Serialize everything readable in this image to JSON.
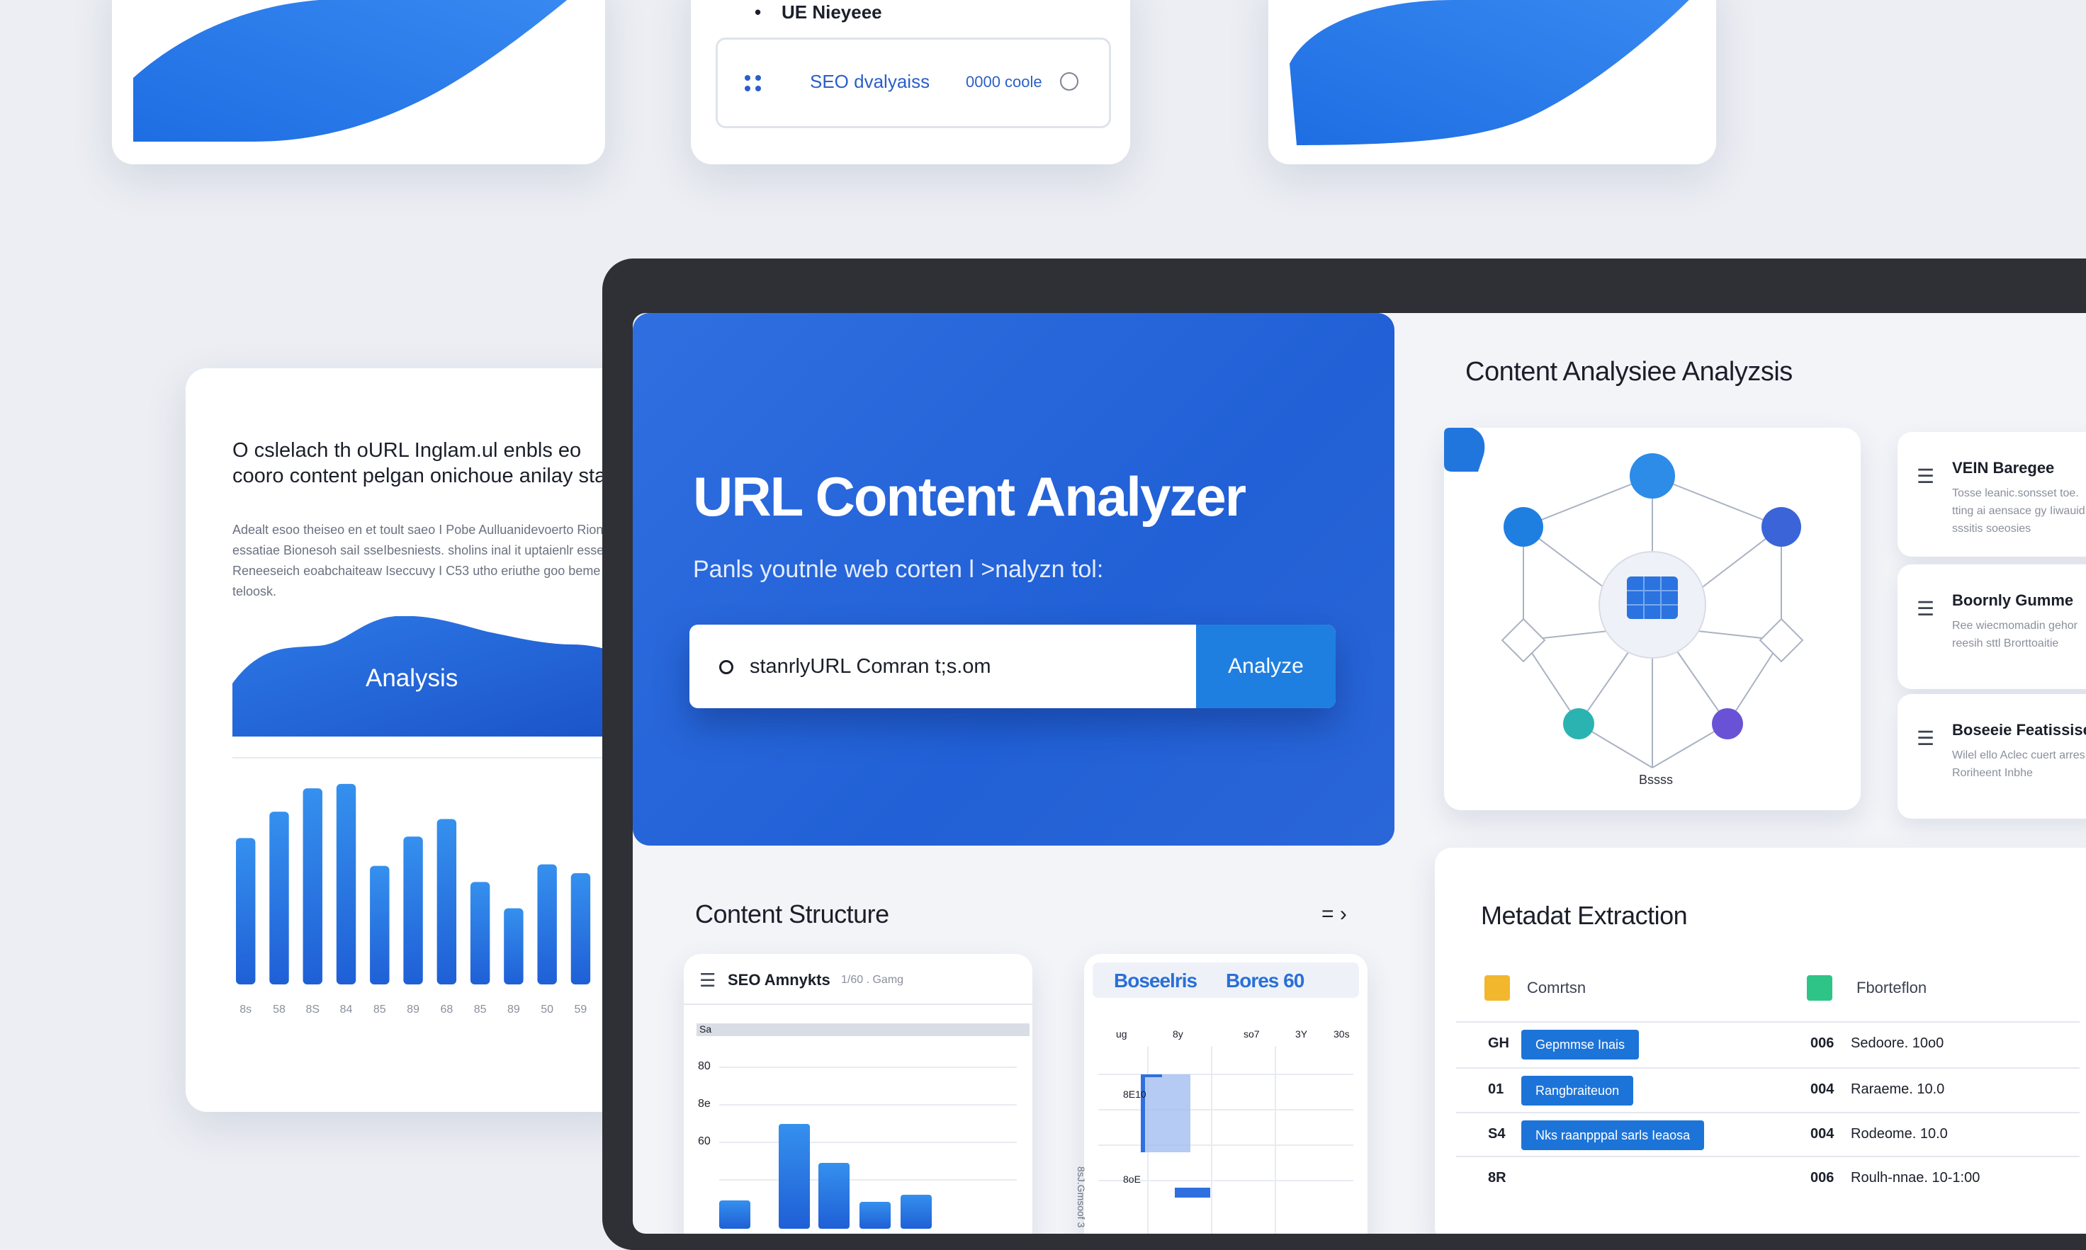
{
  "top_cards": {
    "middle": {
      "bullet_text": "UE Nieyeee",
      "seo_label": "SEO dvalyaiss",
      "value_label": "0000 coole"
    }
  },
  "left_card": {
    "title": "O cslelach th oURL Inglam.ul enbls eo cooro content pelgan onichoue anilay stact.",
    "body": "Adealt esoo theiseo en et toult saeo I Pobe Aulluanidevoerto Rionetur essatiae Bionesoh saiI sseIbesniests. sholins inal it uptaienlr essesh n Reneeseich eoabchaiteaw Iseccuvy I C53 utho eriuthe goo beme teloosk.",
    "wave_label": "Analysis"
  },
  "chart_data": {
    "type": "bar",
    "categories": [
      "8s",
      "58",
      "8S",
      "84",
      "85",
      "89",
      "68",
      "85",
      "89",
      "50",
      "59"
    ],
    "values": [
      100,
      118,
      134,
      137,
      81,
      101,
      113,
      70,
      52,
      82,
      76
    ],
    "ylim": [
      0,
      150
    ],
    "color": "#2f7ae4"
  },
  "hero": {
    "title": "URL Content Analyzer",
    "subtitle": "Panls youtnle web corten l >nalyzn tol:",
    "search_value": "stanrlyURL Comran t;s.om",
    "analyze_label": "Analyze"
  },
  "content_analysis": {
    "title": "Content Analysiee Analyzsis",
    "node_label": "Bssss",
    "side_items": [
      {
        "title": "VEIN Baregee",
        "desc": "Tosse leanic.sonsset toe. tting ai aensace gy Iiwauid sssitis soeosies"
      },
      {
        "title": "Boornly Gumme",
        "desc": "Ree wiecmomadin gehor reesih sttl Brorttoaitie"
      },
      {
        "title": "Boseeie Featissise",
        "desc": "Wilel ello Aclec cuert arres Roriheent Inbhe"
      }
    ]
  },
  "content_structure": {
    "title": "Content Structure",
    "menu_glyph": "= ›",
    "seo_card": {
      "title": "SEO Amnykts",
      "sub": "1/60 . Gamg",
      "y_ticks": [
        "80",
        "8e",
        "60"
      ],
      "head_label": "Sa"
    },
    "bores_card": {
      "tab1": "Boseelris",
      "tab2": "Bores 60",
      "cols": [
        "ug",
        "8y",
        "so7",
        "3Y",
        "30s"
      ],
      "y_ticks": [
        "8E10",
        "8oE"
      ],
      "side": "8sJ.Gmsoof 3"
    }
  },
  "metadata": {
    "title": "Metadat Extraction",
    "legend": [
      {
        "label": "Comrtsn",
        "color": "#f3b72d"
      },
      {
        "label": "Fborteflon",
        "color": "#2fc487"
      }
    ],
    "rows": [
      {
        "k": "GH",
        "tag": "Gepmmse Inais",
        "n": "006",
        "v": "Sedoore. 10o0"
      },
      {
        "k": "01",
        "tag": "Rangbraiteuon",
        "n": "004",
        "v": "Raraeme. 10.0"
      },
      {
        "k": "S4",
        "tag": "Nks   raanpppal sarls Ieaosa",
        "n": "004",
        "v": "Rodeome. 10.0"
      },
      {
        "k": "8R",
        "tag": "",
        "n": "006",
        "v": "Roulh-nnae. 10-1:00"
      }
    ]
  }
}
